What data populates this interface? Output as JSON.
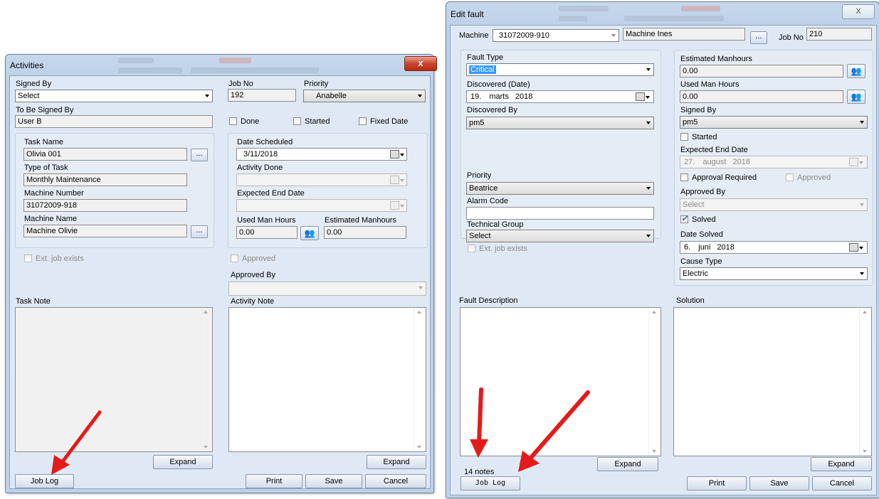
{
  "colors": {
    "arrow": "#e31b1b",
    "selection": "#3399ff"
  },
  "activities": {
    "title": "Activities",
    "close_symbol": "x",
    "signed_by": {
      "label": "Signed By",
      "value": "Select"
    },
    "job_no": {
      "label": "Job No",
      "value": "192"
    },
    "priority": {
      "label": "Priority",
      "value": "Anabelle"
    },
    "to_be_signed_by": {
      "label": "To Be Signed By",
      "value": "User B"
    },
    "done_label": "Done",
    "started_label": "Started",
    "fixed_date_label": "Fixed Date",
    "task_name": {
      "label": "Task Name",
      "value": "Olivia 001"
    },
    "type_of_task": {
      "label": "Type of Task",
      "value": "Monthly Maintenance"
    },
    "machine_number": {
      "label": "Machine Number",
      "value": "31072009-918"
    },
    "machine_name": {
      "label": "Machine Name",
      "value": "Machine Olivie"
    },
    "date_scheduled": {
      "label": "Date Scheduled",
      "value": "3/11/2018"
    },
    "activity_done": {
      "label": "Activity Done",
      "value": ""
    },
    "expected_end_date": {
      "label": "Expected End Date",
      "value": ""
    },
    "used_man_hours": {
      "label": "Used Man Hours",
      "value": "0.00"
    },
    "estimated_manhours": {
      "label": "Estimated Manhours",
      "value": "0.00"
    },
    "ext_job_exists_label": "Ext. job exists",
    "approved_label": "Approved",
    "approved_by": {
      "label": "Approved By",
      "value": ""
    },
    "task_note_label": "Task Note",
    "activity_note_label": "Activity Note",
    "expand_label": "Expand",
    "job_log_label": "Job Log",
    "print_label": "Print",
    "save_label": "Save",
    "cancel_label": "Cancel",
    "ellipsis": "..."
  },
  "edit_fault": {
    "title": "Edit fault",
    "close_symbol": "X",
    "machine": {
      "label": "Machine",
      "number": "31072009-910",
      "name": "Machine Ines"
    },
    "job_no": {
      "label": "Job No",
      "value": "210"
    },
    "fault_type": {
      "label": "Fault Type",
      "value": "Critical"
    },
    "discovered_date": {
      "label": "Discovered (Date)",
      "day": "19.",
      "month": "marts",
      "year": "2018"
    },
    "discovered_by": {
      "label": "Discovered By",
      "value": "pm5"
    },
    "priority": {
      "label": "Priority",
      "value": "Beatrice"
    },
    "alarm_code": {
      "label": "Alarm Code",
      "value": ""
    },
    "technical_group": {
      "label": "Technical Group",
      "value": "Select"
    },
    "ext_job_exists_label": "Ext. job exists",
    "estimated_manhours": {
      "label": "Estimated Manhours",
      "value": "0.00"
    },
    "used_man_hours": {
      "label": "Used Man Hours",
      "value": "0.00"
    },
    "signed_by": {
      "label": "Signed By",
      "value": "pm5"
    },
    "started_label": "Started",
    "expected_end_date": {
      "label": "Expected End Date",
      "day": "27.",
      "month": "august",
      "year": "2018"
    },
    "approval_required_label": "Approval Required",
    "approved_label": "Approved",
    "approved_by": {
      "label": "Approved By",
      "value": "Select"
    },
    "solved_label": "Solved",
    "date_solved": {
      "label": "Date Solved",
      "day": "6.",
      "month": "juni",
      "year": "2018"
    },
    "cause_type": {
      "label": "Cause Type",
      "value": "Electric"
    },
    "fault_description_label": "Fault Description",
    "solution_label": "Solution",
    "notes_count": "14 notes",
    "expand_label": "Expand",
    "job_log_label": "Job Log",
    "print_label": "Print",
    "save_label": "Save",
    "cancel_label": "Cancel",
    "ellipsis": "..."
  }
}
